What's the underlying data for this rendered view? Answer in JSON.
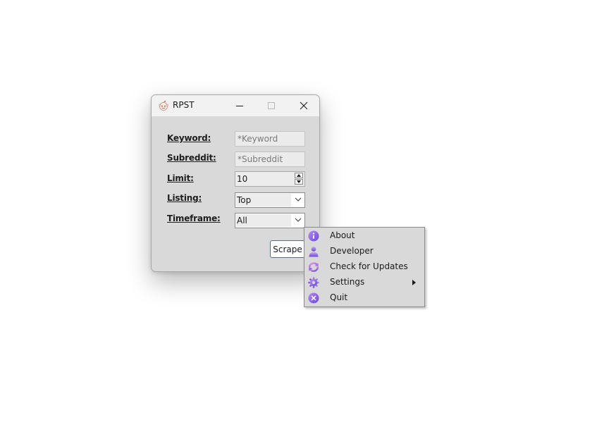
{
  "window": {
    "title": "RPST",
    "app_icon": "reddit-alien-icon",
    "controls": [
      "minimize-icon",
      "maximize-icon",
      "close-icon"
    ]
  },
  "form": {
    "keyword": {
      "label": "Keyword:",
      "placeholder": "*Keyword",
      "value": ""
    },
    "subreddit": {
      "label": "Subreddit:",
      "placeholder": "*Subreddit",
      "value": ""
    },
    "limit": {
      "label": "Limit:",
      "value": "10"
    },
    "listing": {
      "label": "Listing:",
      "selected": "Top"
    },
    "timeframe": {
      "label": "Timeframe:",
      "selected": "All"
    },
    "scrape_label": "Scrape"
  },
  "context_menu": {
    "items": [
      {
        "label": "About",
        "icon": "info-icon"
      },
      {
        "label": "Developer",
        "icon": "person-icon"
      },
      {
        "label": "Check for Updates",
        "icon": "refresh-icon"
      },
      {
        "label": "Settings",
        "icon": "gear-icon",
        "submenu": true
      },
      {
        "label": "Quit",
        "icon": "close-circle-icon"
      }
    ]
  },
  "colors": {
    "window_bg": "#d9d9d9",
    "titlebar_bg": "#f2f2f2",
    "accent_blue": "#2d77c7",
    "icon_purple": "#8a5fe0",
    "icon_light_purple": "#c27be8"
  }
}
